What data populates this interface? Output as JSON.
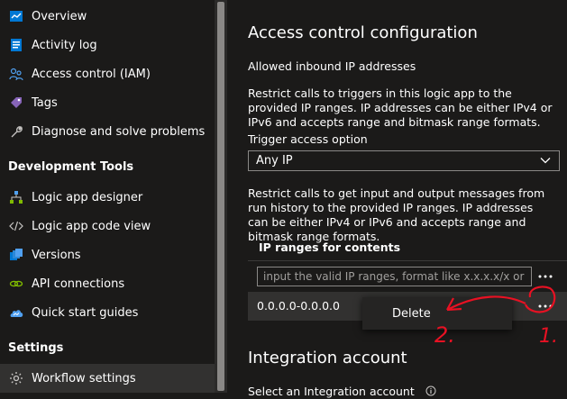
{
  "sidebar": {
    "items": [
      {
        "label": "Overview",
        "icon": "overview-icon"
      },
      {
        "label": "Activity log",
        "icon": "activity-log-icon"
      },
      {
        "label": "Access control (IAM)",
        "icon": "people-icon"
      },
      {
        "label": "Tags",
        "icon": "tag-icon"
      },
      {
        "label": "Diagnose and solve problems",
        "icon": "wrench-icon"
      }
    ],
    "dev_tools": {
      "header": "Development Tools",
      "items": [
        {
          "label": "Logic app designer",
          "icon": "designer-icon"
        },
        {
          "label": "Logic app code view",
          "icon": "code-icon"
        },
        {
          "label": "Versions",
          "icon": "versions-icon"
        },
        {
          "label": "API connections",
          "icon": "link-icon"
        },
        {
          "label": "Quick start guides",
          "icon": "cloud-icon"
        }
      ]
    },
    "settings": {
      "header": "Settings",
      "items": [
        {
          "label": "Workflow settings",
          "icon": "gear-icon",
          "selected": true
        }
      ]
    }
  },
  "main": {
    "heading": "Access control configuration",
    "allowed_label": "Allowed inbound IP addresses",
    "trigger_desc": "Restrict calls to triggers in this logic app to the provided IP ranges. IP addresses can be either IPv4 or IPv6 and accepts range and bitmask range formats.",
    "trigger_option_label": "Trigger access option",
    "trigger_option_value": "Any IP",
    "contents_desc": "Restrict calls to get input and output messages from run history to the provided IP ranges. IP addresses can be either IPv4 or IPv6 and accepts range and bitmask range formats.",
    "ip_ranges_header": "IP ranges for contents",
    "ip_input_placeholder": "input the valid IP ranges, format like x.x.x.x/x or ...",
    "ip_row_value": "0.0.0.0-0.0.0.0",
    "context_menu": {
      "delete_label": "Delete"
    },
    "integration_heading": "Integration account",
    "integration_label": "Select an Integration account"
  },
  "annotations": {
    "marker_1": "1.",
    "marker_2": "2.",
    "color": "#e81123"
  },
  "colors": {
    "background": "#1b1a19",
    "selected": "#323130",
    "border": "#8a8886"
  }
}
